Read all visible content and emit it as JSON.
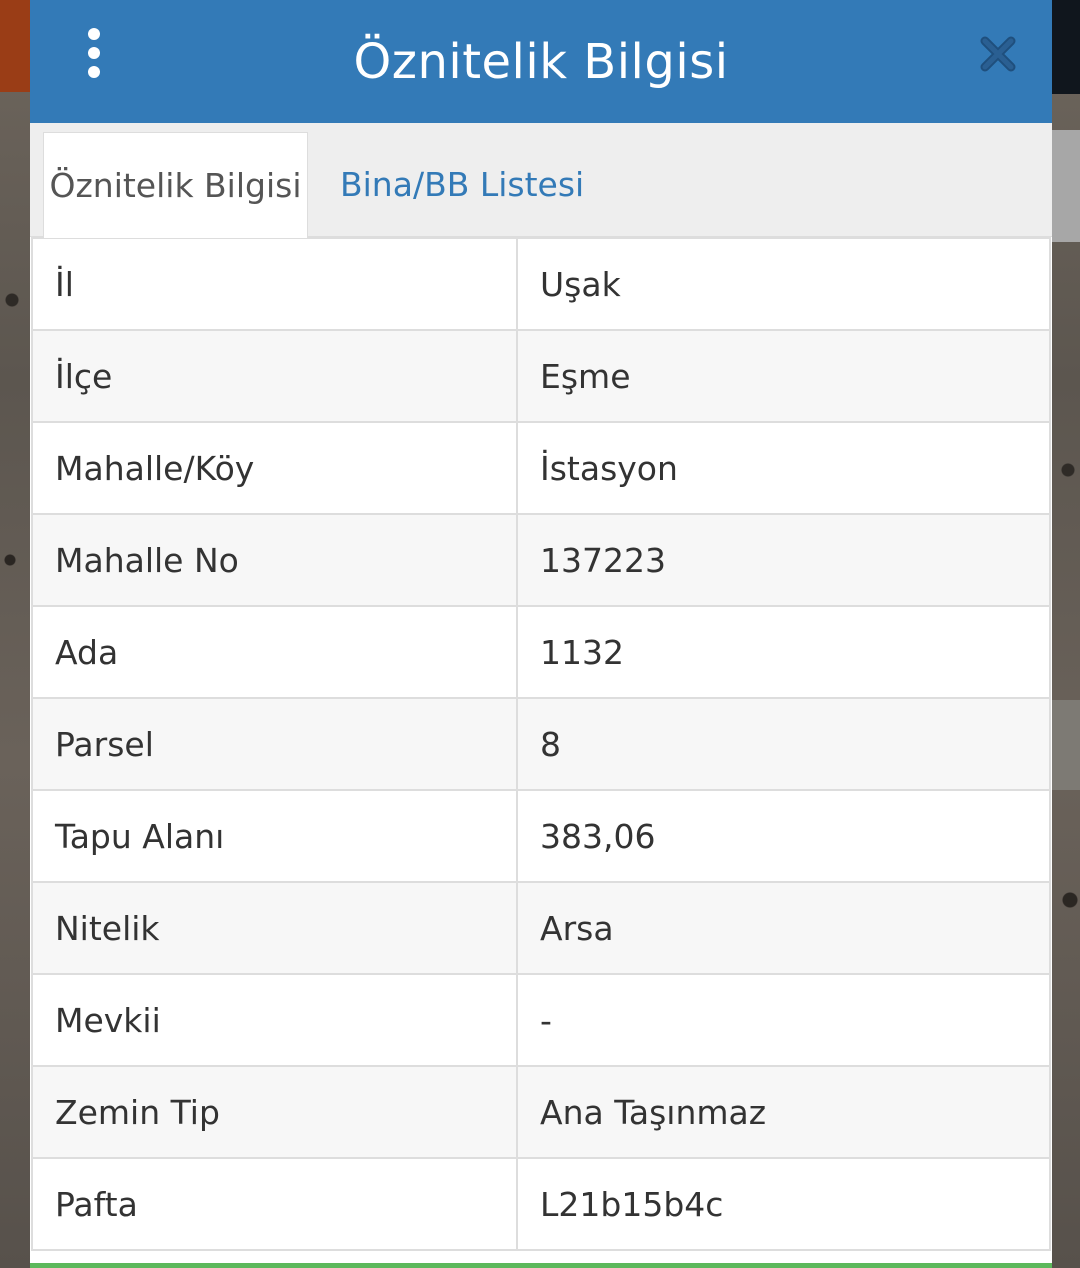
{
  "header": {
    "title": "Öznitelik Bilgisi",
    "menu_icon": "more-vertical-icon",
    "close_icon": "close-icon",
    "bg_color": "#337ab7"
  },
  "tabs": [
    {
      "label": "Öznitelik Bilgisi",
      "active": true
    },
    {
      "label": "Bina/BB Listesi",
      "active": false
    }
  ],
  "attributes": [
    {
      "key": "İl",
      "value": "Uşak"
    },
    {
      "key": "İlçe",
      "value": "Eşme"
    },
    {
      "key": "Mahalle/Köy",
      "value": "İstasyon"
    },
    {
      "key": "Mahalle No",
      "value": "137223"
    },
    {
      "key": "Ada",
      "value": "1132"
    },
    {
      "key": "Parsel",
      "value": "8"
    },
    {
      "key": "Tapu Alanı",
      "value": "383,06"
    },
    {
      "key": "Nitelik",
      "value": "Arsa"
    },
    {
      "key": "Mevkii",
      "value": "-"
    },
    {
      "key": "Zemin Tip",
      "value": "Ana Taşınmaz"
    },
    {
      "key": "Pafta",
      "value": "L21b15b4c"
    }
  ],
  "colors": {
    "accent": "#337ab7",
    "link": "#337ab7",
    "footer_bar": "#5cb85c"
  }
}
